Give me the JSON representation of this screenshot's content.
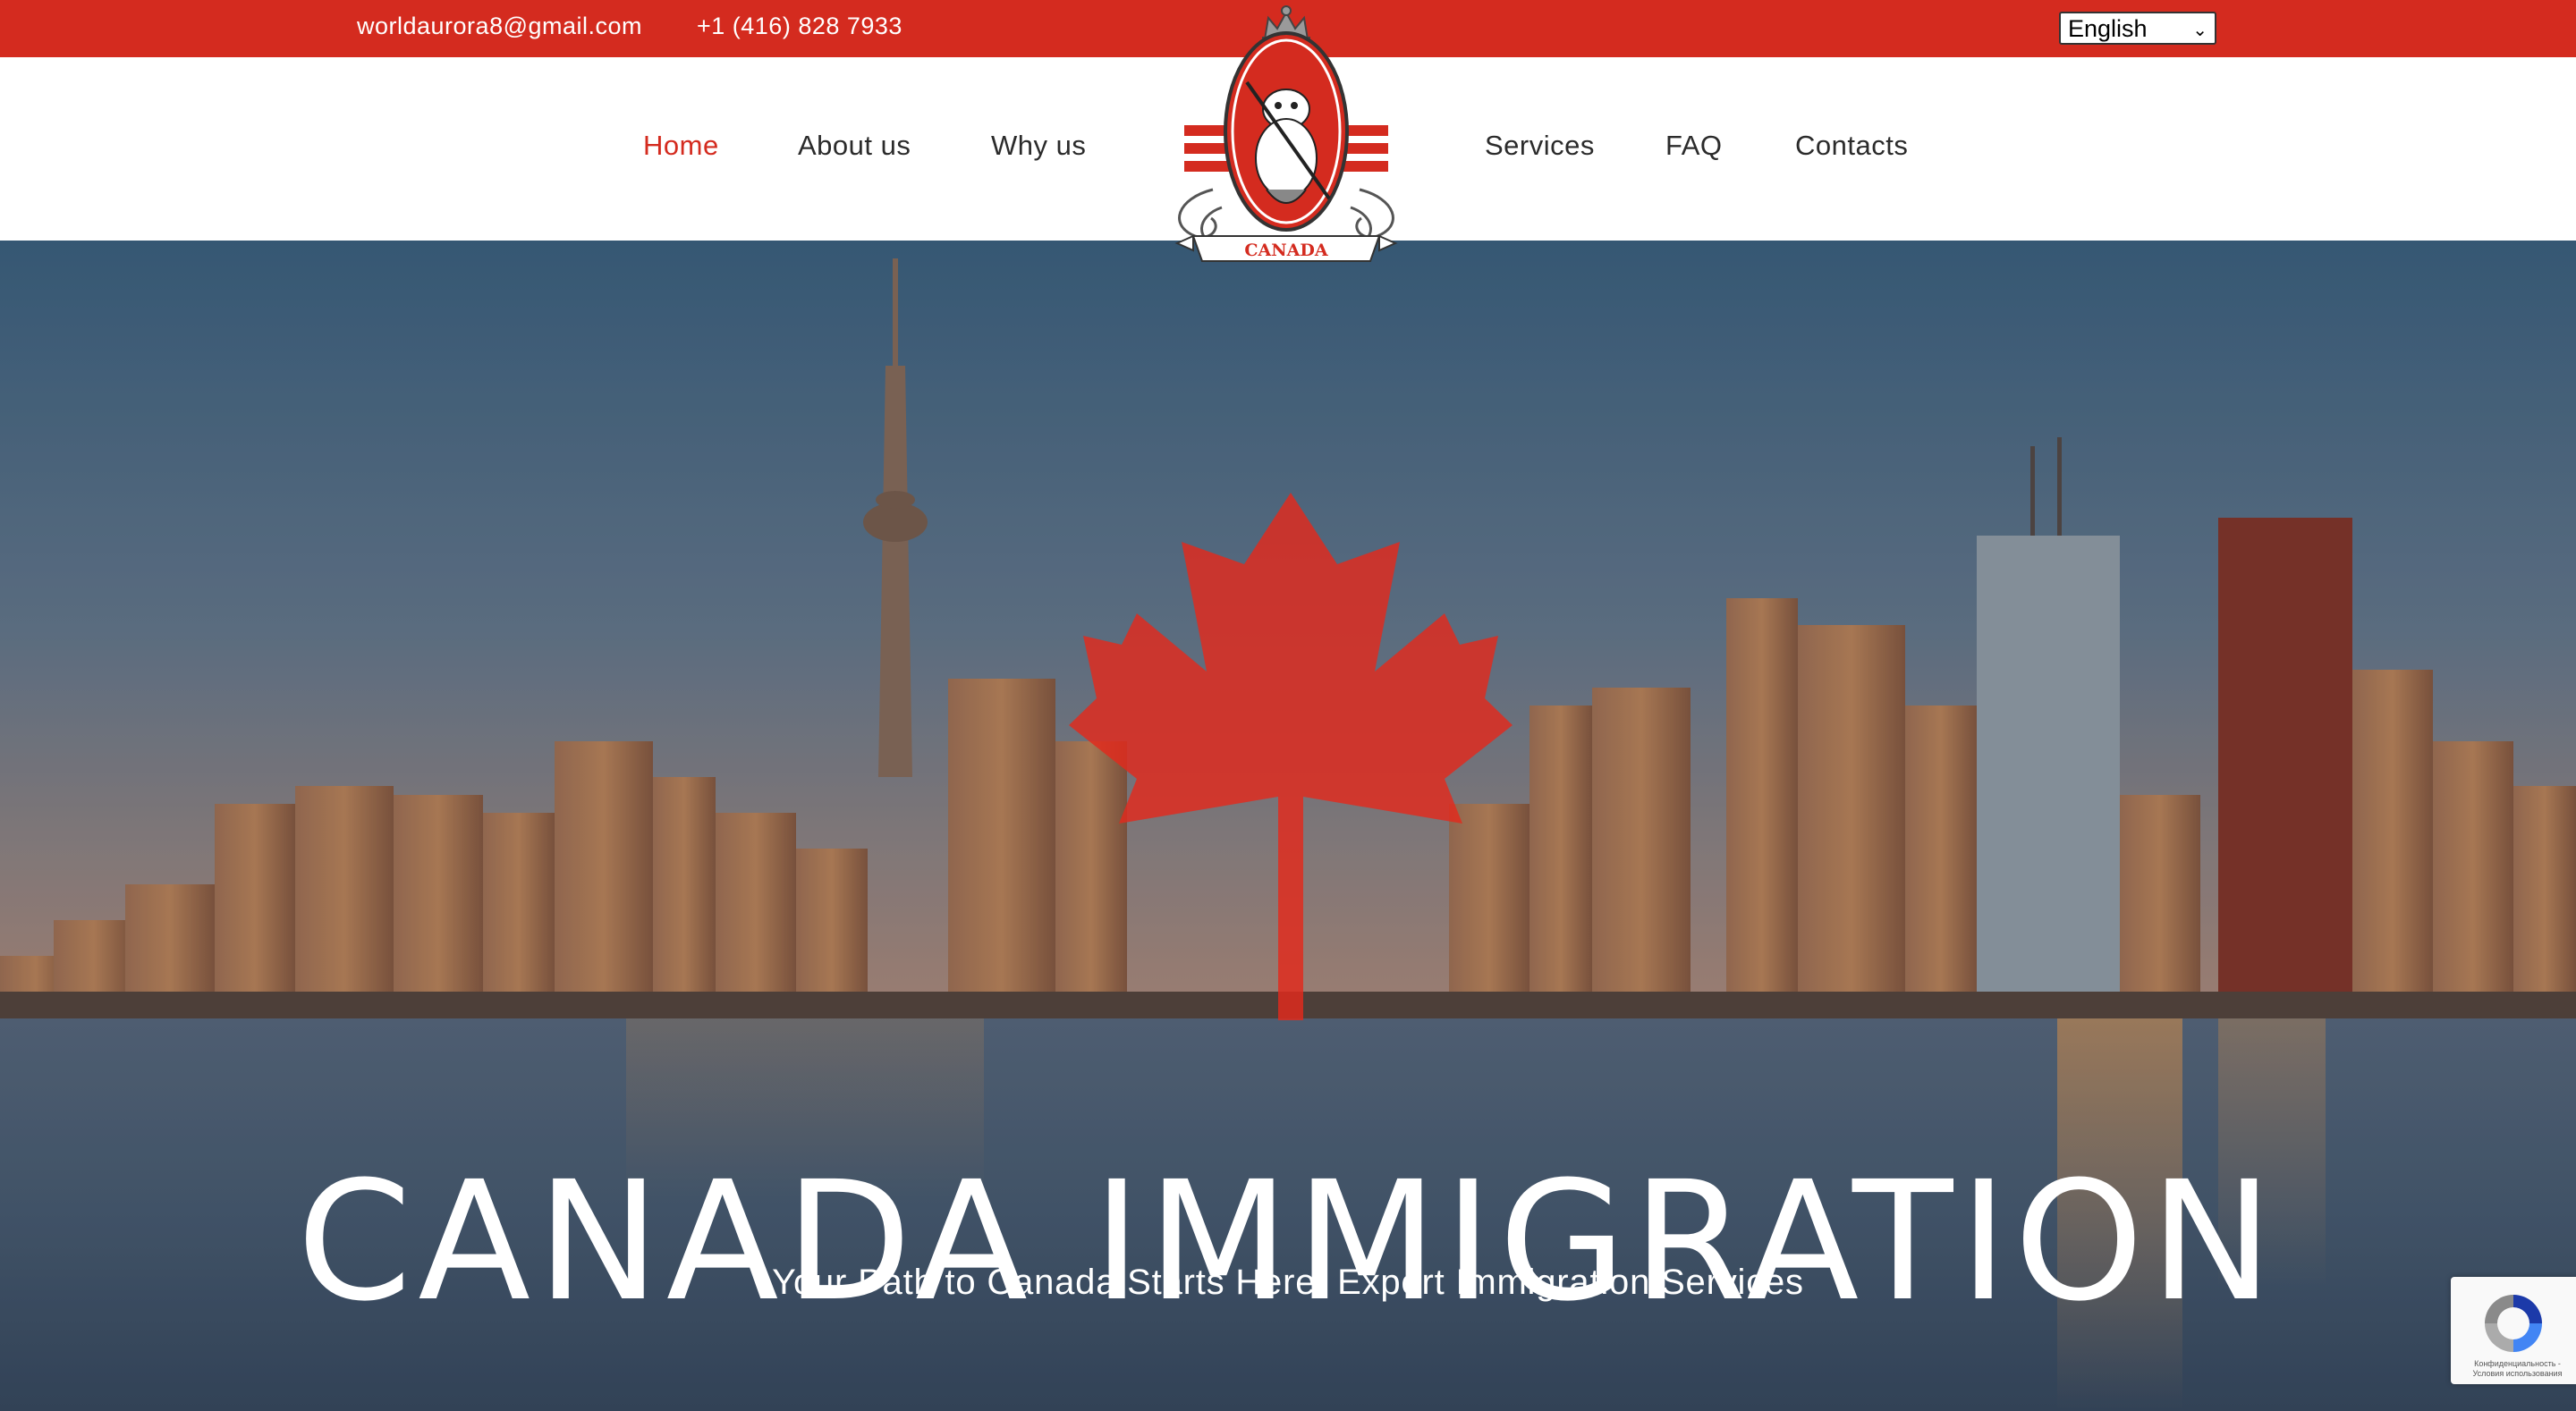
{
  "topbar": {
    "email": "worldaurora8@gmail.com",
    "phone": "+1 (416) 828 7933",
    "language": {
      "selected": "English"
    },
    "background_color": "#d42b1f"
  },
  "nav": {
    "items": [
      {
        "label": "Home",
        "active": true
      },
      {
        "label": "About us"
      },
      {
        "label": "Why us"
      },
      {
        "label": "Services"
      },
      {
        "label": "FAQ"
      },
      {
        "label": "Contacts"
      }
    ],
    "active_color": "#d42b1f"
  },
  "logo": {
    "banner_text": "CANADA",
    "icon": "beaver-crest-icon"
  },
  "hero": {
    "title": "CANADA IMMIGRATION",
    "subtitle": "Your Path to Canada Starts Here: Expert Immigration Services",
    "overlay_icon": "maple-leaf-icon",
    "background": "toronto-skyline-image"
  },
  "recaptcha": {
    "terms_line1": "Конфиденциальность -",
    "terms_line2": "Условия использования"
  }
}
